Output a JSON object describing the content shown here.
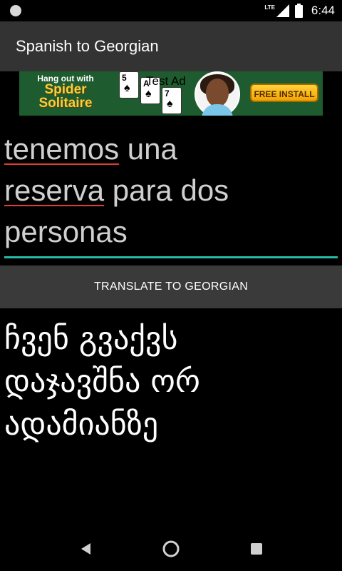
{
  "status_bar": {
    "network": "LTE",
    "time": "6:44"
  },
  "app_bar": {
    "title": "Spanish to Georgian"
  },
  "ad": {
    "small_line": "Hang out with",
    "title_line1": "Spider",
    "title_line2": "Solitaire",
    "label": "Test Ad",
    "cta": "FREE INSTALL",
    "card_values": [
      "5",
      "A",
      "7"
    ]
  },
  "input": {
    "words": [
      {
        "text": "tenemos",
        "misspelled": true
      },
      {
        "text": " una",
        "misspelled": false
      },
      {
        "text": "reserva",
        "misspelled": true
      },
      {
        "text": " para dos",
        "misspelled": false
      },
      {
        "text": "personas",
        "misspelled": false
      }
    ]
  },
  "translate_button": {
    "label": "TRANSLATE TO GEORGIAN"
  },
  "result": {
    "lines": [
      "ჩვენ გვაქვს",
      "დაჯავშნა ორ",
      "ადამიანზე"
    ]
  },
  "colors": {
    "accent_underline": "#26b9a6",
    "spell_underline": "#e53935",
    "app_bar": "#333333"
  }
}
